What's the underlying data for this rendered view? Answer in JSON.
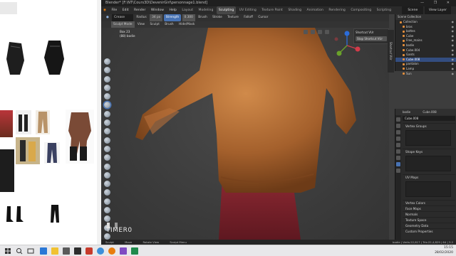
{
  "window": {
    "title": "Blender* [F:\\NT\\Cours3D\\DevenirGirl\\personnage1.blend]",
    "controls": "—  ❐  ✕"
  },
  "menubar": {
    "items": [
      "File",
      "Edit",
      "Render",
      "Window",
      "Help"
    ],
    "workspaces": [
      "Layout",
      "Modeling",
      "Sculpting",
      "UV Editing",
      "Texture Paint",
      "Shading",
      "Animation",
      "Rendering",
      "Compositing",
      "Scripting"
    ],
    "active_workspace": "Sculpting",
    "scene": "Scene",
    "view_layer": "View Layer"
  },
  "tool_header": {
    "brush": "Crease",
    "radius_label": "Radius",
    "radius_value": "34 px",
    "strength_label": "Strength",
    "strength_value": "0.300",
    "items": [
      "Brush",
      "Stroke",
      "Texture",
      "Falloff",
      "Cursor"
    ]
  },
  "view_header": {
    "mode": "Sculpt Mode",
    "items": [
      "View",
      "Sculpt",
      "Brush",
      "Hide/Mask"
    ]
  },
  "viewport": {
    "info_line1": "Box 23",
    "info_line2": "(88) bodie",
    "object_name": "TIMER0",
    "sidebar_tab": "Shortcut VUr",
    "shortcut_panel_title": "Shortcut VUr",
    "shortcut_button": "Stop Shortcut VUr"
  },
  "outliner": {
    "header": "Scene Collection",
    "rows": [
      {
        "label": "Collection",
        "selected": false
      },
      {
        "label": "bras",
        "selected": false
      },
      {
        "label": "bottes",
        "selected": false
      },
      {
        "label": "Cube",
        "selected": false
      },
      {
        "label": "Free_mains",
        "selected": false
      },
      {
        "label": "bodie",
        "selected": false
      },
      {
        "label": "Cube.004",
        "selected": false
      },
      {
        "label": "Gants",
        "selected": false
      },
      {
        "label": "Cube.008",
        "selected": true
      },
      {
        "label": "pantalon",
        "selected": false
      },
      {
        "label": "Lamp",
        "selected": false
      },
      {
        "label": "Sun",
        "selected": false
      }
    ]
  },
  "properties": {
    "header_left": "bodie",
    "header_right": "Cube.008",
    "mesh_name": "Cube.008",
    "sections": [
      "Vertex Groups",
      "Shape Keys",
      "UV Maps",
      "Vertex Colors",
      "Face Maps",
      "Normals",
      "Texture Space",
      "Geometry Data",
      "Custom Properties"
    ]
  },
  "statusbar": {
    "items": [
      "Sculpt",
      "Move",
      "Rotate View",
      "Sculpt Menu"
    ],
    "stats": "bodie | Verts:22,617 | Tris:22,4,829 | 64 | 3.2"
  },
  "taskbar": {
    "time": "15:15",
    "date": "28/02/2020"
  }
}
